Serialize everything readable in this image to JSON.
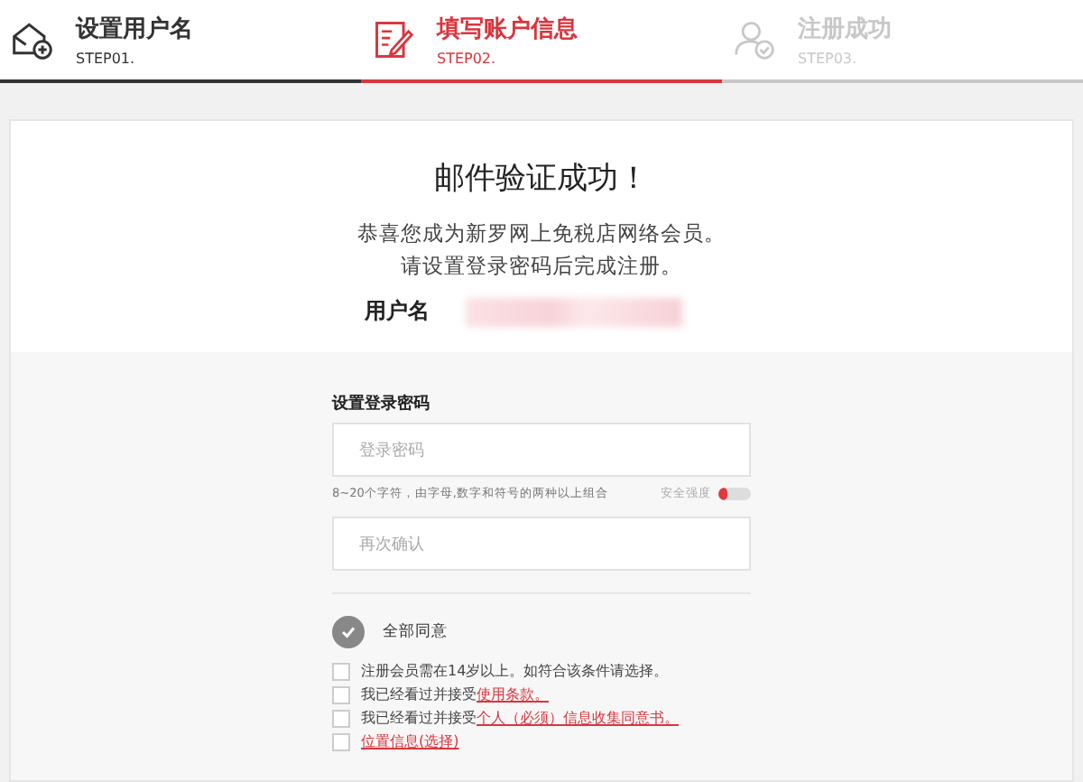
{
  "steps": [
    {
      "title": "设置用户名",
      "code": "STEP01.",
      "selected": false,
      "done": true
    },
    {
      "title": "填写账户信息",
      "code": "STEP02.",
      "selected": true,
      "done": false
    },
    {
      "title": "注册成功",
      "code": "STEP03.",
      "selected": false,
      "done": false
    }
  ],
  "heading": "邮件验证成功！",
  "message": [
    "恭喜您成为新罗网上免税店网络会员。",
    "请设置登录密码后完成注册。"
  ],
  "username_label": "用户名",
  "form": {
    "title": "设置登录密码",
    "password": {
      "placeholder": "登录密码"
    },
    "hint": "8~20个字符，由字母,数字和符号的两种以上组合",
    "strength_label": "安全强度",
    "strength": {
      "level": 0.3
    },
    "confirm": {
      "placeholder": "再次确认"
    }
  },
  "agree_all": {
    "label": "全部同意",
    "checked": true
  },
  "terms": [
    {
      "text": "注册会员需在14岁以上。如符合该条件请选择。",
      "checked": false
    },
    {
      "text": "我已经看过并接受",
      "link": "使用条款。",
      "checked": false
    },
    {
      "text": "我已经看过并接受",
      "link": "个人（必须）信息收集同意书。",
      "checked": false
    },
    {
      "link": "位置信息(选择)",
      "checked": false
    }
  ]
}
